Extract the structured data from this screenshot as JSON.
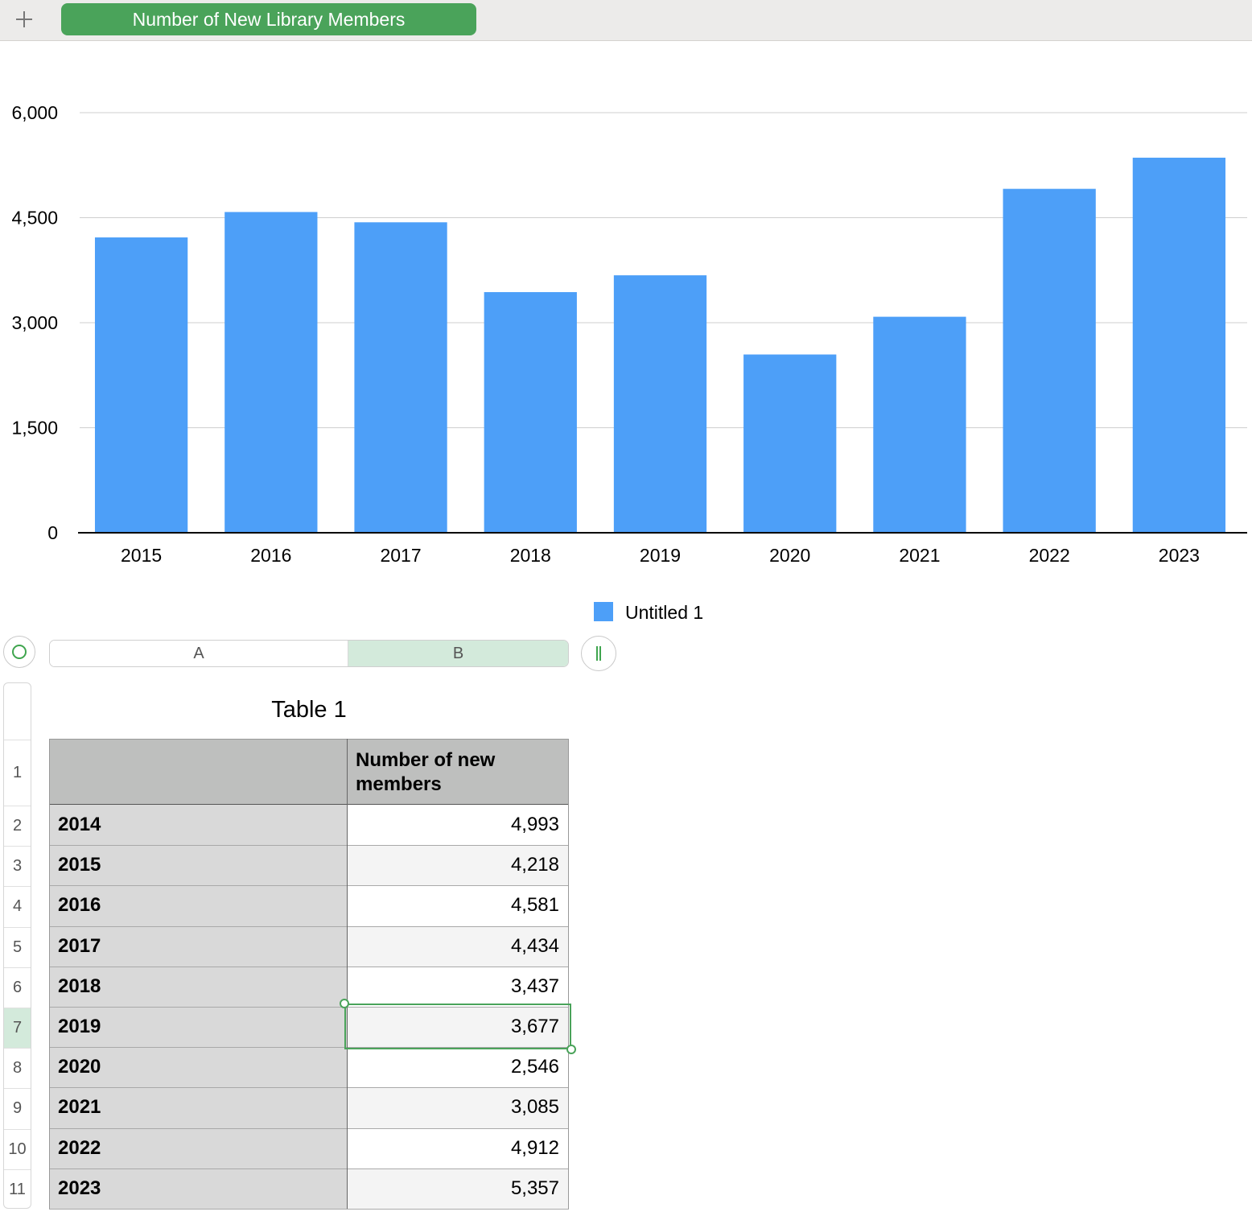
{
  "sheet_bar": {
    "add_icon": "plus-icon",
    "active_tab": "Number of New Library Members"
  },
  "colors": {
    "accent_green": "#4aa35a",
    "bar_blue": "#4d9ff8",
    "selected_column_bg": "#d3eadb"
  },
  "chart_data": {
    "type": "bar",
    "categories": [
      "2015",
      "2016",
      "2017",
      "2018",
      "2019",
      "2020",
      "2021",
      "2022",
      "2023"
    ],
    "series": [
      {
        "name": "Untitled 1",
        "values": [
          4218,
          4581,
          4434,
          3437,
          3677,
          2546,
          3085,
          4912,
          5357
        ]
      }
    ],
    "ylim": [
      0,
      6000
    ],
    "yticks": [
      0,
      1500,
      3000,
      4500,
      6000
    ],
    "ytick_labels": [
      "0",
      "1,500",
      "3,000",
      "4,500",
      "6,000"
    ],
    "grid": true,
    "legend": "bottom-center",
    "title": "",
    "xlabel": "",
    "ylabel": ""
  },
  "table": {
    "title": "Table 1",
    "columns": [
      "A",
      "B"
    ],
    "header": {
      "a": "",
      "b": "Number of new members"
    },
    "row_numbers": [
      "1",
      "2",
      "3",
      "4",
      "5",
      "6",
      "7",
      "8",
      "9",
      "10",
      "11"
    ],
    "selected_row": "7",
    "selected_column": "B",
    "rows": [
      {
        "year": "2014",
        "value": "4,993"
      },
      {
        "year": "2015",
        "value": "4,218"
      },
      {
        "year": "2016",
        "value": "4,581"
      },
      {
        "year": "2017",
        "value": "4,434"
      },
      {
        "year": "2018",
        "value": "3,437"
      },
      {
        "year": "2019",
        "value": "3,677"
      },
      {
        "year": "2020",
        "value": "2,546"
      },
      {
        "year": "2021",
        "value": "3,085"
      },
      {
        "year": "2022",
        "value": "4,912"
      },
      {
        "year": "2023",
        "value": "5,357"
      }
    ]
  }
}
